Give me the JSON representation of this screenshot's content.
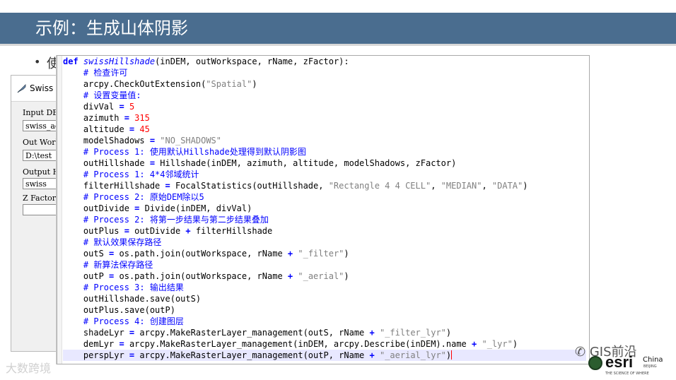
{
  "slide": {
    "title": "示例：生成山体阴影",
    "bullet_text": "使"
  },
  "dialog": {
    "title": "Swiss H",
    "params": [
      {
        "label": "Input DE",
        "value": "swiss_ac"
      },
      {
        "label": "Out Work",
        "value": "D:\\test"
      },
      {
        "label": "Output H",
        "value": "swiss"
      },
      {
        "label": "Z Factor",
        "value": ""
      }
    ]
  },
  "code": {
    "lines": [
      "def swissHillshade(inDEM, outWorkspace, rName, zFactor):",
      "    # 检查许可",
      "    arcpy.CheckOutExtension(\"Spatial\")",
      "    # 设置变量值:",
      "    divVal = 5",
      "    azimuth = 315",
      "    altitude = 45",
      "    modelShadows = \"NO_SHADOWS\"",
      "    # Process 1: 使用默认Hillshade处理得到默认阴影图",
      "    outHillshade = Hillshade(inDEM, azimuth, altitude, modelShadows, zFactor)",
      "    # Process 1: 4*4邻域统计",
      "    filterHillshade = FocalStatistics(outHillshade, \"Rectangle 4 4 CELL\", \"MEDIAN\", \"DATA\")",
      "    # Process 2: 原始DEM除以5",
      "    outDivide = Divide(inDEM, divVal)",
      "    # Process 2: 将第一步结果与第二步结果叠加",
      "    outPlus = outDivide + filterHillshade",
      "    # 默认效果保存路径",
      "    outS = os.path.join(outWorkspace, rName + \"_filter\")",
      "    # 新算法保存路径",
      "    outP = os.path.join(outWorkspace, rName + \"_aerial\")",
      "    # Process 3: 输出结果",
      "    outHillshade.save(outS)",
      "    outPlus.save(outP)",
      "    # Process 4: 创建图层",
      "    shadeLyr = arcpy.MakeRasterLayer_management(outS, rName + \"_filter_lyr\")",
      "    demLyr = arcpy.MakeRasterLayer_management(inDEM, arcpy.Describe(inDEM).name + \"_lyr\")",
      "    perspLyr = arcpy.MakeRasterLayer_management(outP, rName + \"_aerial_lyr\")"
    ],
    "colors": {
      "keyword": "#0000ff",
      "string": "#808080",
      "number": "#ff0000",
      "comment": "#0000ff"
    }
  },
  "watermarks": {
    "left": "大数跨境",
    "right": "GIS前沿"
  },
  "logo": {
    "brand": "esri",
    "region": "China",
    "city": "BEIJING",
    "tagline": "THE SCIENCE OF WHERE"
  },
  "colors": {
    "title_bar": "#4a6d8f"
  }
}
